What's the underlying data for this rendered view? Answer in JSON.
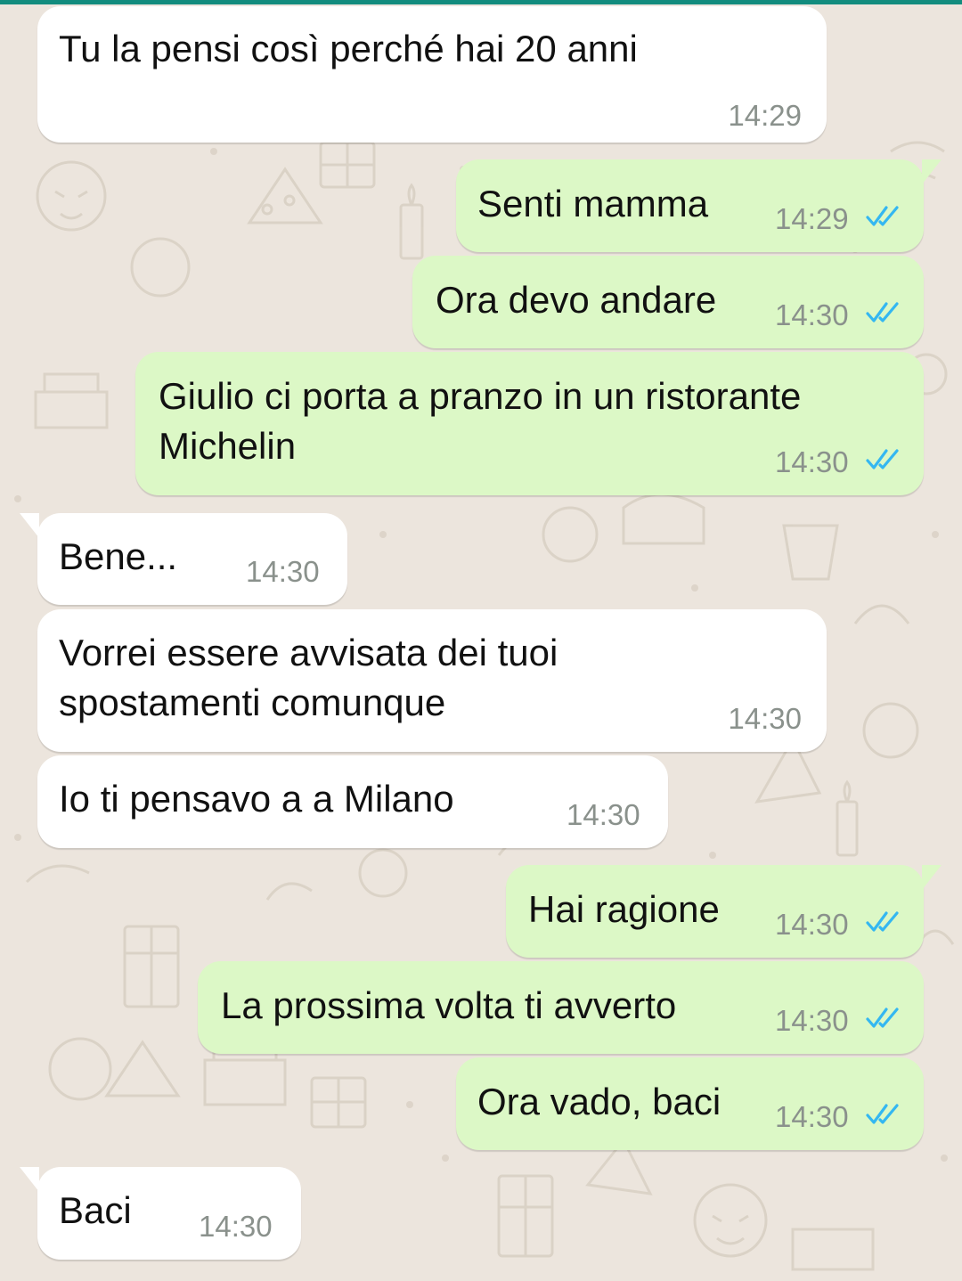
{
  "messages": [
    {
      "text": "Tu la pensi così perché hai 20 anni",
      "time": "14:29",
      "direction": "incoming"
    },
    {
      "text": "Senti mamma",
      "time": "14:29",
      "direction": "outgoing",
      "status": "read"
    },
    {
      "text": "Ora devo andare",
      "time": "14:30",
      "direction": "outgoing",
      "status": "read"
    },
    {
      "text": "Giulio ci porta a pranzo in un ristorante\nMichelin",
      "time": "14:30",
      "direction": "outgoing",
      "status": "read"
    },
    {
      "text": "Bene...",
      "time": "14:30",
      "direction": "incoming"
    },
    {
      "text": "Vorrei essere avvisata dei tuoi\nspostamenti comunque",
      "time": "14:30",
      "direction": "incoming"
    },
    {
      "text": "Io ti pensavo a a Milano",
      "time": "14:30",
      "direction": "incoming"
    },
    {
      "text": "Hai ragione",
      "time": "14:30",
      "direction": "outgoing",
      "status": "read"
    },
    {
      "text": "La prossima volta ti avverto",
      "time": "14:30",
      "direction": "outgoing",
      "status": "read"
    },
    {
      "text": "Ora vado, baci",
      "time": "14:30",
      "direction": "outgoing",
      "status": "read"
    },
    {
      "text": "Baci",
      "time": "14:30",
      "direction": "incoming"
    }
  ],
  "colors": {
    "background": "#ece5dd",
    "incoming_bubble": "#ffffff",
    "outgoing_bubble": "#dcf8c6",
    "read_ticks": "#34b7f1",
    "timestamp": "#8a918c",
    "header_accent": "#128c7e"
  },
  "icons": {
    "read_status": "double-check-icon"
  }
}
